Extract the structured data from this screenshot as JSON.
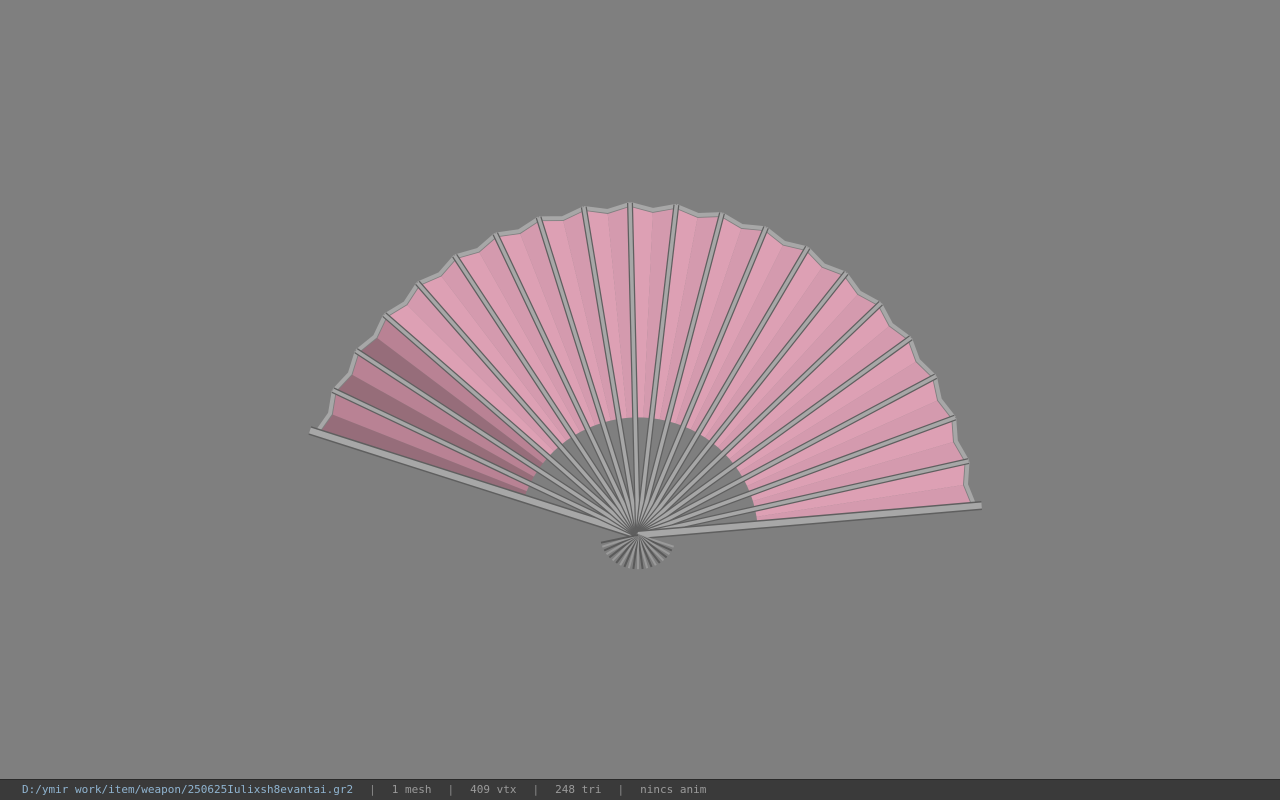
{
  "viewport": {
    "background": "#7f7f7f",
    "model": {
      "name": "folding-fan-model",
      "rib_count": 21,
      "paper_color": "#dda0b4",
      "paper_shadow_color": "#9a6a79",
      "rib_color": "#a7a7a7",
      "rib_edge_color": "#5f5f5f"
    }
  },
  "status": {
    "path": "D:/ymir work/item/weapon/250625Iulixsh8evantai.gr2",
    "mesh": "1 mesh",
    "vertices": "409 vtx",
    "triangles": "248 tri",
    "animation": "nincs anim",
    "separator": "|"
  }
}
